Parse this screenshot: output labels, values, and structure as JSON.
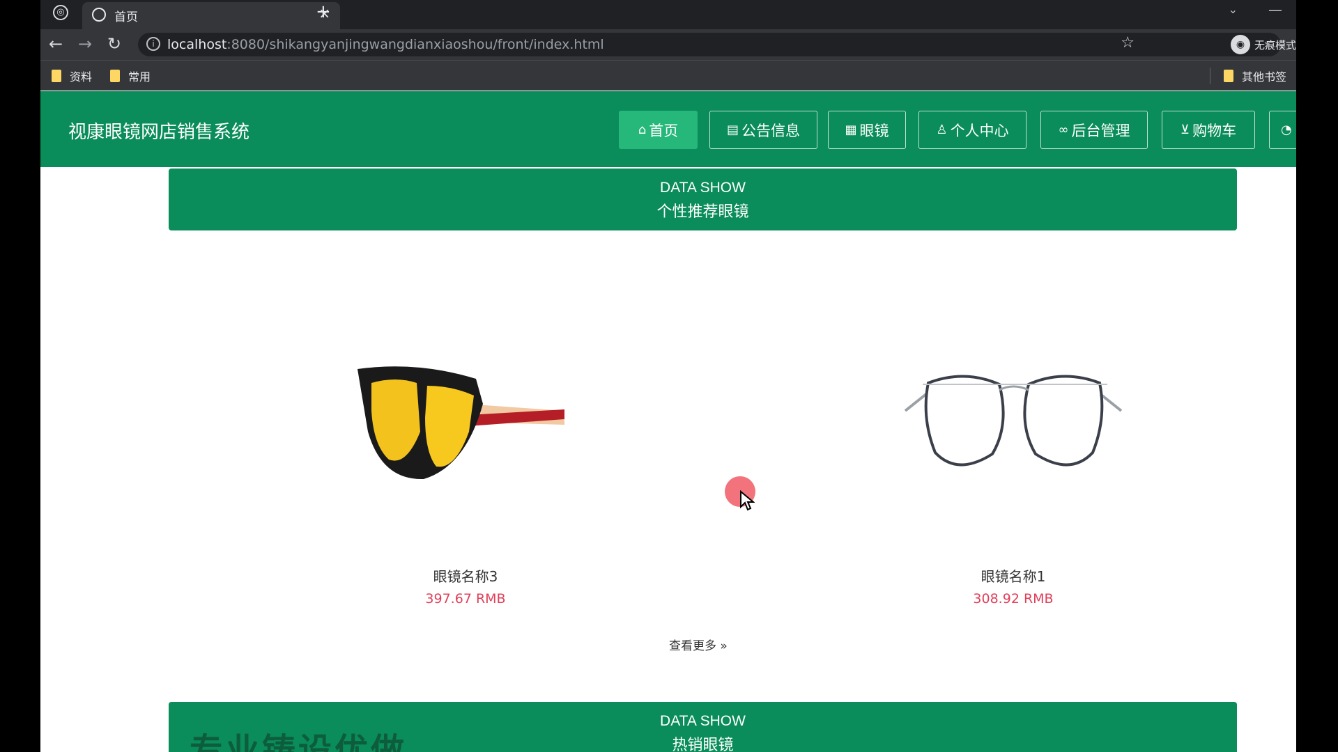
{
  "browser": {
    "tab_title": "首页",
    "tab_close": "×",
    "new_tab": "+",
    "url_host": "localhost",
    "url_path": ":8080/shikangyanjingwangdianxiaoshou/front/index.html",
    "profile_name": "无痕模式",
    "bookmarks": [
      "资料",
      "常用"
    ],
    "other_bookmarks": "其他书签"
  },
  "app": {
    "title": "视康眼镜网店销售系统",
    "nav": [
      {
        "icon": "home-icon",
        "label": "首页"
      },
      {
        "icon": "notice-icon",
        "label": "公告信息"
      },
      {
        "icon": "grid-icon",
        "label": "眼镜"
      },
      {
        "icon": "user-icon",
        "label": "个人中心"
      },
      {
        "icon": "link-icon",
        "label": "后台管理"
      },
      {
        "icon": "cart-icon",
        "label": "购物车"
      }
    ]
  },
  "recommend": {
    "en": "DATA SHOW",
    "cn": "个性推荐眼镜",
    "products": [
      {
        "name": "眼镜名称3",
        "price": "397.67 RMB"
      },
      {
        "name": "眼镜名称1",
        "price": "308.92 RMB"
      }
    ],
    "more": "查看更多"
  },
  "hot": {
    "en": "DATA SHOW",
    "cn": "热销眼镜",
    "overlay": "专业铸设优做"
  },
  "colors": {
    "brand_green": "#0a8d5a",
    "active_green": "#26b77a",
    "price_red": "#e0405a"
  }
}
